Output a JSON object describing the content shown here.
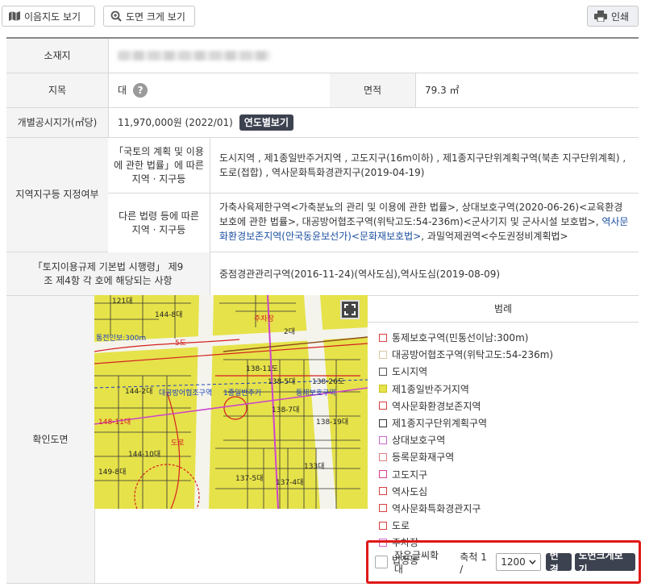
{
  "toolbar": {
    "map_label": "이음지도 보기",
    "big_map_label": "도면 크게 보기",
    "print_label": "인쇄"
  },
  "info": {
    "location_label": "소재지",
    "jimok_label": "지목",
    "jimok_value": "대",
    "help_glyph": "?",
    "area_label": "면적",
    "area_value": "79.3 ㎡",
    "price_label": "개별공시지가(㎡당)",
    "price_value": "11,970,000원 (2022/01)",
    "yearly_button": "연도별보기",
    "zone_label": "지역지구등 지정여부",
    "zone_law1_label": "「국토의 계획 및 이용에 관한 법률」에 따른 지역 · 지구등",
    "zone_law1_value": "도시지역 , 제1종일반주거지역 , 고도지구(16m이하) , 제1종지구단위계획구역(북촌 지구단위계획) , 도로(접합) , 역사문화특화경관지구(2019-04-19)",
    "zone_law2_label": "다른 법령 등에 따른 지역 · 지구등",
    "zone_law2_value_a": "가축사육제한구역<가축분뇨의 관리 및 이용에 관한 법률>, 상대보호구역(2020-06-26)<교육환경 보호에 관한 법률>, 대공방어협조구역(위탁고도:54-236m)<군사기지 및 군사시설 보호법>, ",
    "zone_law2_value_link": "역사문화환경보존지역(안국동윤보선가)<문화재보호법>",
    "zone_law2_value_b": ", 과밀억제권역<수도권정비계획법>",
    "enforce_label": "「토지이용규제 기본법 시행령」 제9조 제4항 각 호에 해당되는 사항",
    "enforce_value": "중점경관관리구역(2016-11-24)(역사도심),역사도심(2019-08-09)",
    "confirm_map_label": "확인도면"
  },
  "map": {
    "labels": [
      "121대",
      "144-8대",
      "주차장",
      "2대",
      "5도",
      "통전인보:300m",
      "138-11도",
      "138-5대",
      "138-26도",
      "144-2대",
      "대공방어협조구역",
      "1종일반주거",
      "통제보호구역",
      "138-7대",
      "138-19대",
      "148-11대",
      "149-8대",
      "도로",
      "137-4대",
      "133대",
      "144-10대",
      "137-5대"
    ]
  },
  "legend": {
    "title": "범례",
    "items": [
      {
        "label": "통제보호구역(민통선이남:300m)",
        "color": "#d94040"
      },
      {
        "label": "대공방어협조구역(위탁고도:54-236m)",
        "color": "#d8c8a0"
      },
      {
        "label": "도시지역",
        "color": "#555555"
      },
      {
        "label": "제1종일반주거지역",
        "color": "#e6e24a"
      },
      {
        "label": "역사문화환경보존지역",
        "color": "#d94040"
      },
      {
        "label": "제1종지구단위계획구역",
        "color": "#333333"
      },
      {
        "label": "상대보호구역",
        "color": "#cc66cc"
      },
      {
        "label": "등록문화재구역",
        "color": "#e08080"
      },
      {
        "label": "고도지구",
        "color": "#d94090"
      },
      {
        "label": "역사도심",
        "color": "#d94040"
      },
      {
        "label": "역사문화특화경관지구",
        "color": "#d94040"
      },
      {
        "label": "도로",
        "color": "#d94040"
      },
      {
        "label": "주차장",
        "color": "#cc66cc"
      },
      {
        "label": "법정동",
        "color": "#999999"
      }
    ]
  },
  "controls": {
    "small_text_label": "작은글씨확대",
    "scale_label": "축척 1 /",
    "scale_value": "1200",
    "change_button": "변경",
    "big_button": "도면크게보기"
  }
}
